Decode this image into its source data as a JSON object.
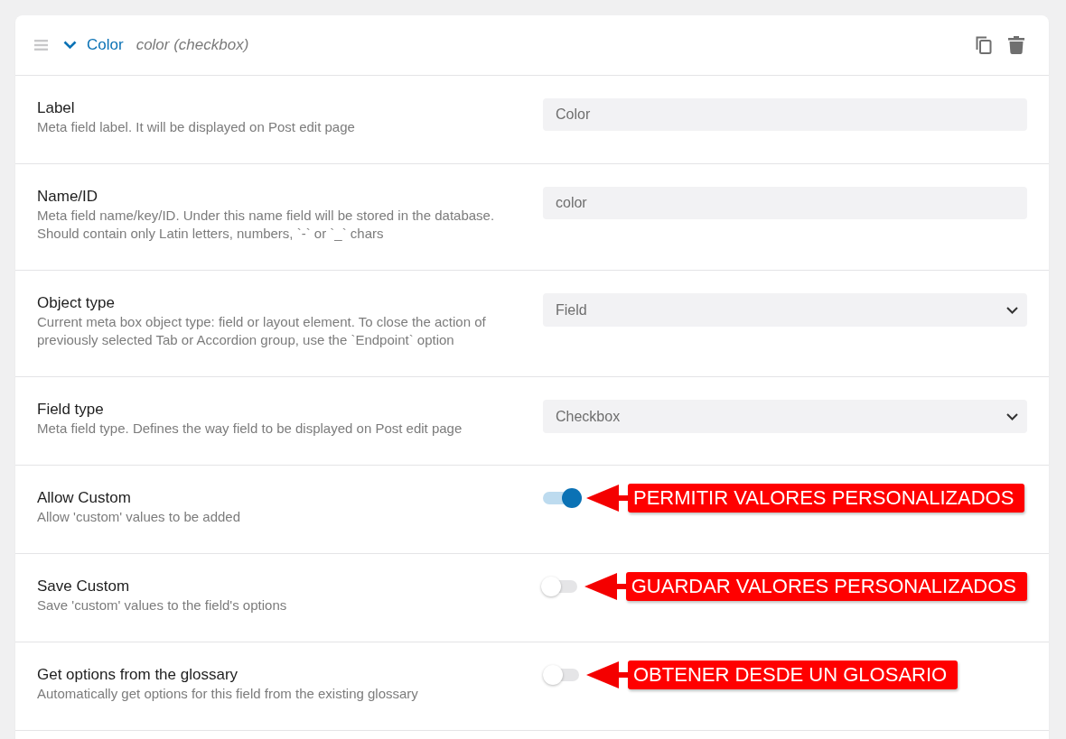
{
  "header": {
    "expanded": true,
    "title": "Color",
    "subtitle": "color (checkbox)"
  },
  "rows": [
    {
      "kind": "text",
      "label": "Label",
      "description": "Meta field label. It will be displayed on Post edit page",
      "value": "Color"
    },
    {
      "kind": "text",
      "label": "Name/ID",
      "description": "Meta field name/key/ID. Under this name field will be stored in the database. Should contain only Latin letters, numbers, `-` or `_` chars",
      "value": "color"
    },
    {
      "kind": "select",
      "label": "Object type",
      "description": "Current meta box object type: field or layout element. To close the action of previously selected Tab or Accordion group, use the `Endpoint` option",
      "value": "Field"
    },
    {
      "kind": "select",
      "label": "Field type",
      "description": "Meta field type. Defines the way field to be displayed on Post edit page",
      "value": "Checkbox"
    },
    {
      "kind": "toggle",
      "label": "Allow Custom",
      "description": "Allow 'custom' values to be added",
      "on": true,
      "annotation": "PERMITIR VALORES PERSONALIZADOS"
    },
    {
      "kind": "toggle",
      "label": "Save Custom",
      "description": "Save 'custom' values to the field's options",
      "on": false,
      "annotation": "GUARDAR VALORES PERSONALIZADOS"
    },
    {
      "kind": "toggle",
      "label": "Get options from the glossary",
      "description": "Automatically get options for this field from the existing glossary",
      "on": false,
      "annotation": "OBTENER DESDE UN GLOSARIO"
    }
  ]
}
